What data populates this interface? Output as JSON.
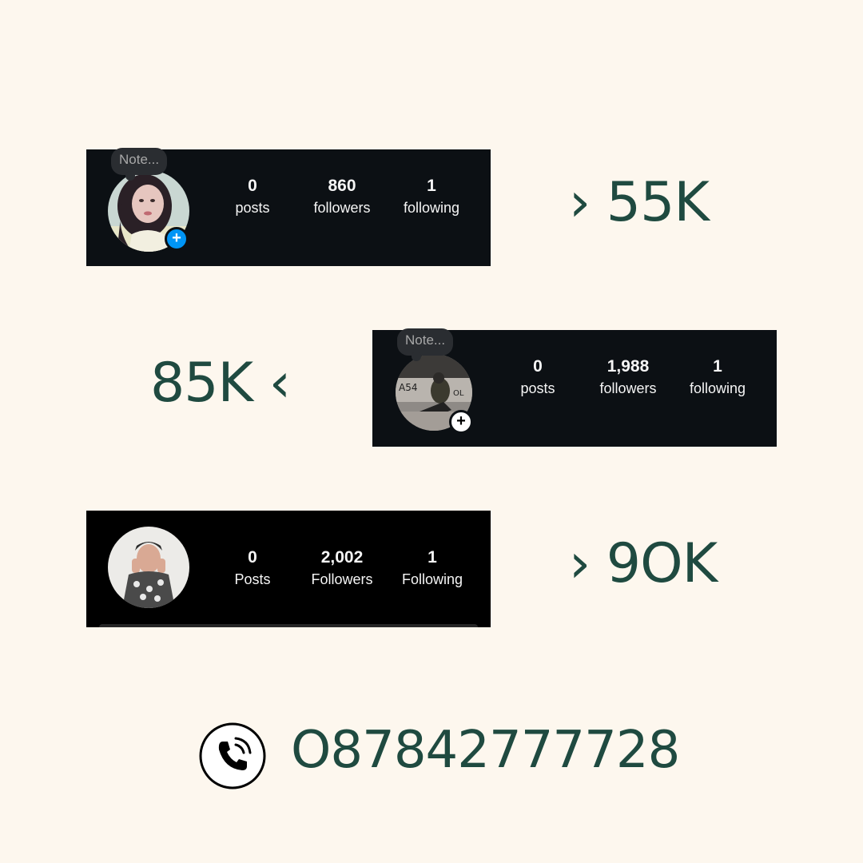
{
  "profiles": [
    {
      "note": "Note...",
      "stats": [
        {
          "value": "0",
          "label": "posts"
        },
        {
          "value": "860",
          "label": "followers"
        },
        {
          "value": "1",
          "label": "following"
        }
      ],
      "price": "› 55K"
    },
    {
      "note": "Note...",
      "stats": [
        {
          "value": "0",
          "label": "posts"
        },
        {
          "value": "1,988",
          "label": "followers"
        },
        {
          "value": "1",
          "label": "following"
        }
      ],
      "price": "85K ‹"
    },
    {
      "stats": [
        {
          "value": "0",
          "label": "Posts"
        },
        {
          "value": "2,002",
          "label": "Followers"
        },
        {
          "value": "1",
          "label": "Following"
        }
      ],
      "price": "› 9OK"
    }
  ],
  "contact": {
    "icon": "phone-call-icon",
    "phone": "O87842777728"
  },
  "colors": {
    "background": "#fdf7ee",
    "text_accent": "#1f4a40",
    "card_dark": "#0c1014",
    "card_black": "#000000",
    "plus_blue": "#0095f6"
  }
}
